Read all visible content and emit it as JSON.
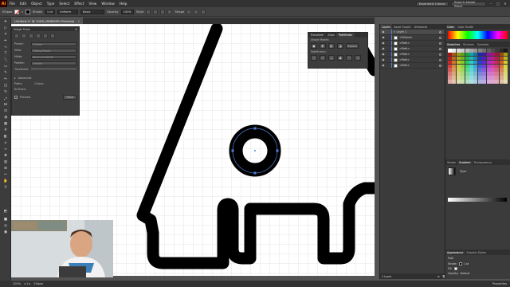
{
  "app": {
    "logo": "Ai",
    "menu": [
      "File",
      "Edit",
      "Object",
      "Type",
      "Select",
      "Effect",
      "View",
      "Window",
      "Help"
    ],
    "workspace": "Essentials Classic",
    "search_placeholder": "Search Adobe Stock"
  },
  "control_bar": {
    "selection_label": "Ellipse",
    "stroke_label": "Stroke",
    "stroke_weight": "1 pt",
    "profile_label": "Uniform",
    "brush_label": "Basic",
    "opacity_label": "Opacity",
    "opacity_value": "100%",
    "style_label": "Style",
    "shape_label": "Shape"
  },
  "document": {
    "tab_title": "Untitled-1* @ 100% (RGB/GPU Preview)",
    "zoom": "100%",
    "status_tool": "Ellipse"
  },
  "image_trace": {
    "title": "Image Trace",
    "rows": [
      {
        "label": "Preset:",
        "value": "Custom"
      },
      {
        "label": "View:",
        "value": "Tracing Result"
      },
      {
        "label": "Mode:",
        "value": "Black and White"
      },
      {
        "label": "Palette:",
        "value": "Limited"
      },
      {
        "label": "Threshold:",
        "value": ""
      }
    ],
    "advanced_label": "Advanced",
    "paths_label": "Paths:",
    "anchors_label": "Anchors:",
    "colors_label": "Colors:",
    "preview_label": "Preview",
    "trace_label": "Trace"
  },
  "pathfinder": {
    "tabs": [
      "Transform",
      "Align",
      "Pathfinder"
    ],
    "active_tab": "Pathfinder",
    "shape_modes_label": "Shape Modes:",
    "pathfinders_label": "Pathfinders:",
    "expand_label": "Expand"
  },
  "layers_panel": {
    "tabs": [
      "Layers",
      "Asset Export",
      "Artboards"
    ],
    "layer_name": "Layer 1",
    "items": [
      "<Ellipse>",
      "<Path>",
      "<Path>",
      "<Path>",
      "<Path>",
      "<Path>"
    ],
    "footer": "1 Layer"
  },
  "color_panel": {
    "tabs": [
      "Color",
      "Color Guide"
    ],
    "swatch_tabs": [
      "Swatches",
      "Brushes",
      "Symbols"
    ],
    "stroke_tabs": [
      "Stroke",
      "Gradient",
      "Transparency"
    ],
    "gradient_type_label": "Type:",
    "appearance_tabs": [
      "Appearance",
      "Graphic Styles"
    ],
    "appearance_title": "Path",
    "appearance_rows": [
      {
        "label": "Stroke:",
        "value": "1 pt"
      },
      {
        "label": "Fill:",
        "value": ""
      },
      {
        "label": "Opacity:",
        "value": "Default"
      }
    ],
    "properties_label": "Properties"
  },
  "colors": {
    "accent": "#4f7fd8",
    "canvas": "#ffffff",
    "shape_fill": "#000000",
    "selection": "#4f7fd8"
  }
}
